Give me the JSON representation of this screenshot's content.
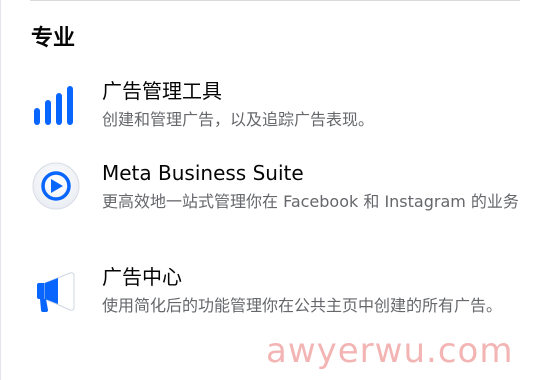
{
  "section": {
    "title": "专业"
  },
  "items": [
    {
      "icon": "ads-manager-bars-icon",
      "title": "广告管理工具",
      "description": "创建和管理广告，以及追踪广告表现。"
    },
    {
      "icon": "meta-business-suite-icon",
      "title": "Meta Business Suite",
      "description": "更高效地一站式管理你在 Facebook 和 Instagram 的业务"
    },
    {
      "icon": "megaphone-icon",
      "title": "广告中心",
      "description": "使用简化后的功能管理你在公共主页中创建的所有广告。"
    }
  ],
  "watermark": "awyerwu.com",
  "colors": {
    "brand_blue": "#0866ff",
    "text_primary": "#050505",
    "text_secondary": "#65676b",
    "watermark": "#f2a7a7"
  }
}
